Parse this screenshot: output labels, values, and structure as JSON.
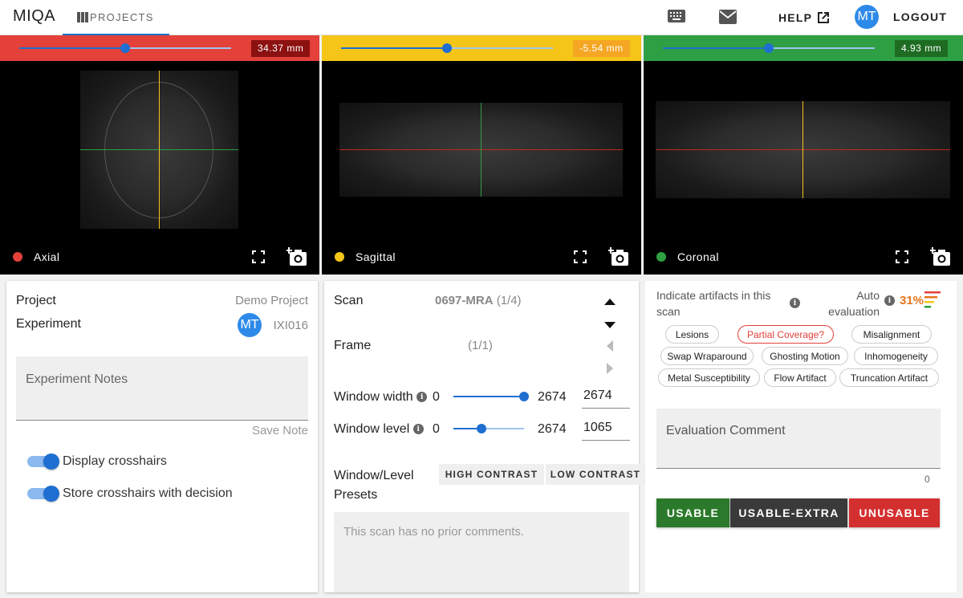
{
  "app": {
    "title": "MIQA"
  },
  "nav": {
    "projects_label": "PROJECTS",
    "help_label": "HELP",
    "logout_label": "LOGOUT",
    "user_initials": "MT"
  },
  "viewers": [
    {
      "name": "Axial",
      "color": "#e3413a",
      "position": "34.37 mm",
      "slider_fraction": 0.5
    },
    {
      "name": "Sagittal",
      "color": "#f5c518",
      "label_color": "#f5a623",
      "position": "-5.54 mm",
      "slider_fraction": 0.5
    },
    {
      "name": "Coronal",
      "color": "#2ea043",
      "label_color": "#1e6b22",
      "position": "4.93 mm",
      "slider_fraction": 0.5
    }
  ],
  "project_panel": {
    "project_label": "Project",
    "project_value": "Demo Project",
    "experiment_label": "Experiment",
    "experiment_value": "IXI016",
    "experiment_avatar": "MT",
    "notes_placeholder": "Experiment Notes",
    "save_note_label": "Save Note",
    "toggles": [
      {
        "label": "Display crosshairs",
        "on": true
      },
      {
        "label": "Store crosshairs with decision",
        "on": true
      }
    ]
  },
  "scan_panel": {
    "scan_label": "Scan",
    "scan_name": "0697-MRA",
    "scan_index": "(1/4)",
    "frame_label": "Frame",
    "frame_index": "(1/1)",
    "window_width": {
      "label": "Window width",
      "min": "0",
      "max": "2674",
      "value": "2674",
      "fraction": 1.0
    },
    "window_level": {
      "label": "Window level",
      "min": "0",
      "max": "2674",
      "value": "1065",
      "fraction": 0.398
    },
    "presets_label_1": "Window/Level",
    "presets_label_2": "Presets",
    "presets": [
      "HIGH CONTRAST",
      "LOW CONTRAST"
    ],
    "prior_comments": "This scan has no prior comments."
  },
  "evaluation_panel": {
    "artifacts_label_1": "Indicate artifacts in this",
    "artifacts_label_2": "scan",
    "auto_label_1": "Auto",
    "auto_label_2": "evaluation",
    "auto_score": "31%",
    "artifacts": [
      {
        "label": "Lesions",
        "flagged": false
      },
      {
        "label": "Partial Coverage?",
        "flagged": true
      },
      {
        "label": "Misalignment",
        "flagged": false
      },
      {
        "label": "Swap Wraparound",
        "flagged": false
      },
      {
        "label": "Ghosting Motion",
        "flagged": false
      },
      {
        "label": "Inhomogeneity",
        "flagged": false
      },
      {
        "label": "Metal Susceptibility",
        "flagged": false
      },
      {
        "label": "Flow Artifact",
        "flagged": false
      },
      {
        "label": "Truncation Artifact",
        "flagged": false
      }
    ],
    "comment_placeholder": "Evaluation Comment",
    "comment_count": "0",
    "decisions": [
      {
        "label": "USABLE",
        "color": "#2b7a2b"
      },
      {
        "label": "USABLE-EXTRA",
        "color": "#3a3a3a"
      },
      {
        "label": "UNUSABLE",
        "color": "#d32f2f"
      }
    ]
  }
}
